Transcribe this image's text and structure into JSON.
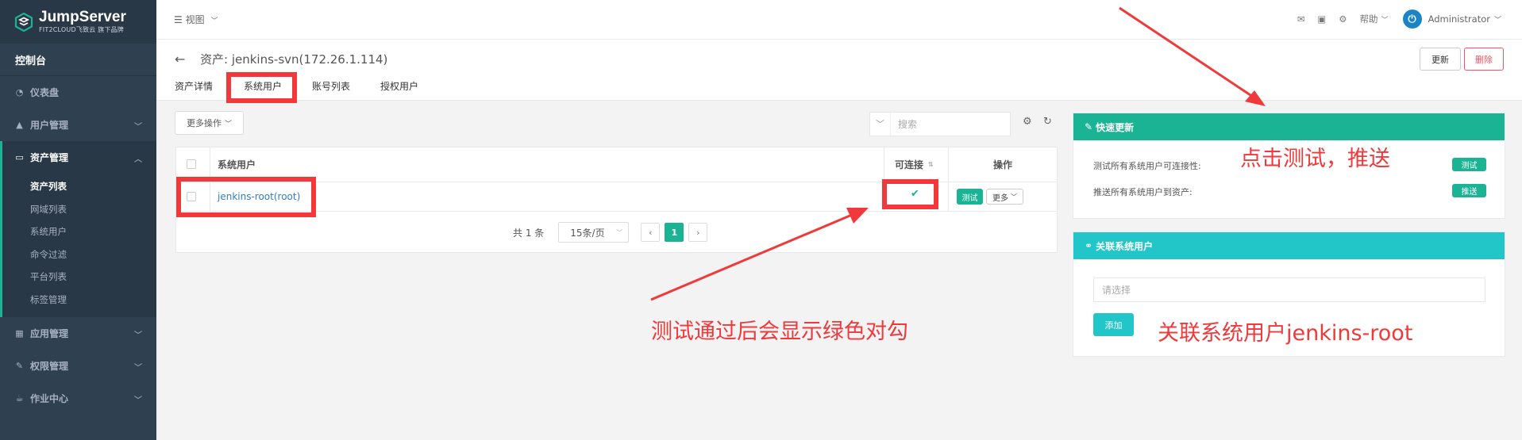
{
  "sidebar": {
    "brand": "JumpServer",
    "brand_sub": "FIT2CLOUD飞致云 旗下品牌",
    "console": "控制台",
    "items": [
      {
        "label": "仪表盘"
      },
      {
        "label": "用户管理"
      },
      {
        "label": "资产管理"
      },
      {
        "label": "应用管理"
      },
      {
        "label": "权限管理"
      },
      {
        "label": "作业中心"
      }
    ],
    "sub_items": [
      "资产列表",
      "网域列表",
      "系统用户",
      "命令过滤",
      "平台列表",
      "标签管理"
    ]
  },
  "topbar": {
    "view": "视图",
    "help": "帮助",
    "user": "Administrator"
  },
  "page": {
    "title": "资产: jenkins-svn(172.26.1.114)",
    "update_btn": "更新",
    "delete_btn": "删除",
    "tabs": [
      "资产详情",
      "系统用户",
      "账号列表",
      "授权用户"
    ]
  },
  "toolbar": {
    "more_ops": "更多操作",
    "search_placeholder": "搜索"
  },
  "table": {
    "columns": [
      "系统用户",
      "可连接",
      "操作"
    ],
    "rows": [
      {
        "system_user": "jenkins-root(root)",
        "connectable": true,
        "test_btn": "测试",
        "more_btn": "更多"
      }
    ]
  },
  "pagination": {
    "total": "共 1 条",
    "page_size": "15条/页",
    "current": "1"
  },
  "quick_update": {
    "title": "快速更新",
    "rows": [
      {
        "label": "测试所有系统用户可连接性:",
        "button": "测试"
      },
      {
        "label": "推送所有系统用户到资产:",
        "button": "推送"
      }
    ]
  },
  "related_users": {
    "title": "关联系统用户",
    "placeholder": "请选择",
    "add_btn": "添加"
  },
  "annotations": {
    "click_test": "点击测试，推送",
    "green_check": "测试通过后会显示绿色对勾",
    "relate": "关联系统用户jenkins-root"
  },
  "colors": {
    "sidebar_bg": "#2f4050",
    "primary": "#1ab394",
    "cyan": "#23c6c8",
    "danger": "#ed5565",
    "annotation_red": "#f0393b"
  }
}
